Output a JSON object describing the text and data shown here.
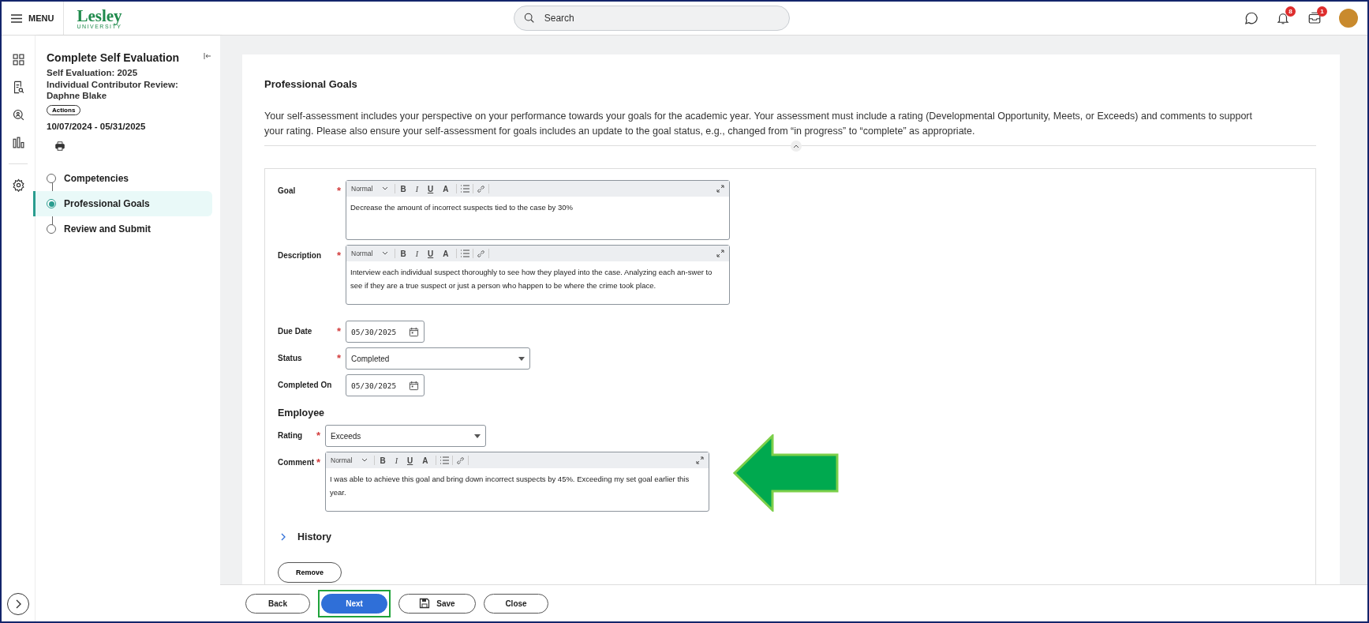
{
  "top_bar": {
    "menu_label": "MENU",
    "logo": "Lesley",
    "logo_subtitle": "UNIVERSITY",
    "search_placeholder": "Search",
    "notifications_badge": "8",
    "inbox_badge": "1"
  },
  "sidebar": {
    "title": "Complete Self Evaluation",
    "subtitle": "Self Evaluation: 2025",
    "review": "Individual Contributor Review: Daphne Blake",
    "actions_label": "Actions",
    "date_range": "10/07/2024 - 05/31/2025",
    "steps": [
      {
        "label": "Competencies",
        "selected": false
      },
      {
        "label": "Professional Goals",
        "selected": true
      },
      {
        "label": "Review and Submit",
        "selected": false
      }
    ]
  },
  "section": {
    "title": "Professional Goals",
    "description": "Your self-assessment includes your perspective on your performance towards your goals for the academic year. Your assessment must include a rating (Developmental Opportunity, Meets, or Exceeds) and comments to support your rating. Please also ensure your self-assessment for goals includes an update to the goal status, e.g., changed from “in progress” to “complete” as appropriate."
  },
  "fields": [
    {
      "kind": "editor",
      "label": "Goal",
      "required": true,
      "style": "Normal",
      "toolbar": [
        "B",
        "I",
        "U",
        "A"
      ],
      "value": "Decrease the amount of incorrect suspects tied to the case by 30%"
    },
    {
      "kind": "editor",
      "label": "Description",
      "required": true,
      "style": "Normal",
      "toolbar": [
        "B",
        "I",
        "U",
        "A"
      ],
      "value": "Interview each individual suspect thoroughly to see how they played into the case. Analyzing each an-swer to see if they are a true suspect or just a person who happen to be where the crime took place."
    },
    {
      "kind": "date",
      "label": "Due Date",
      "required": true,
      "value": "05/30/2025"
    },
    {
      "kind": "select",
      "label": "Status",
      "required": true,
      "value": "Completed"
    },
    {
      "kind": "date",
      "label": "Completed On",
      "required": false,
      "value": "05/30/2025"
    }
  ],
  "employee": {
    "heading": "Employee",
    "fields": [
      {
        "kind": "select",
        "label": "Rating",
        "required": true,
        "value": "Exceeds"
      },
      {
        "kind": "editor",
        "label": "Comment",
        "required": true,
        "style": "Normal",
        "toolbar": [
          "B",
          "I",
          "U",
          "A"
        ],
        "value": "I was able to achieve this goal and bring down incorrect suspects by 45%. Exceeding my set goal earlier this year."
      }
    ]
  },
  "history": {
    "label": "History",
    "expanded": false
  },
  "remove_label": "Remove",
  "required_mark": "*",
  "actions": [
    {
      "label": "Back",
      "kind": "secondary",
      "highlighted": false
    },
    {
      "label": "Next",
      "kind": "primary",
      "highlighted": true
    },
    {
      "label": "Save",
      "kind": "save",
      "highlighted": false
    },
    {
      "label": "Close",
      "kind": "secondary",
      "highlighted": false
    }
  ]
}
